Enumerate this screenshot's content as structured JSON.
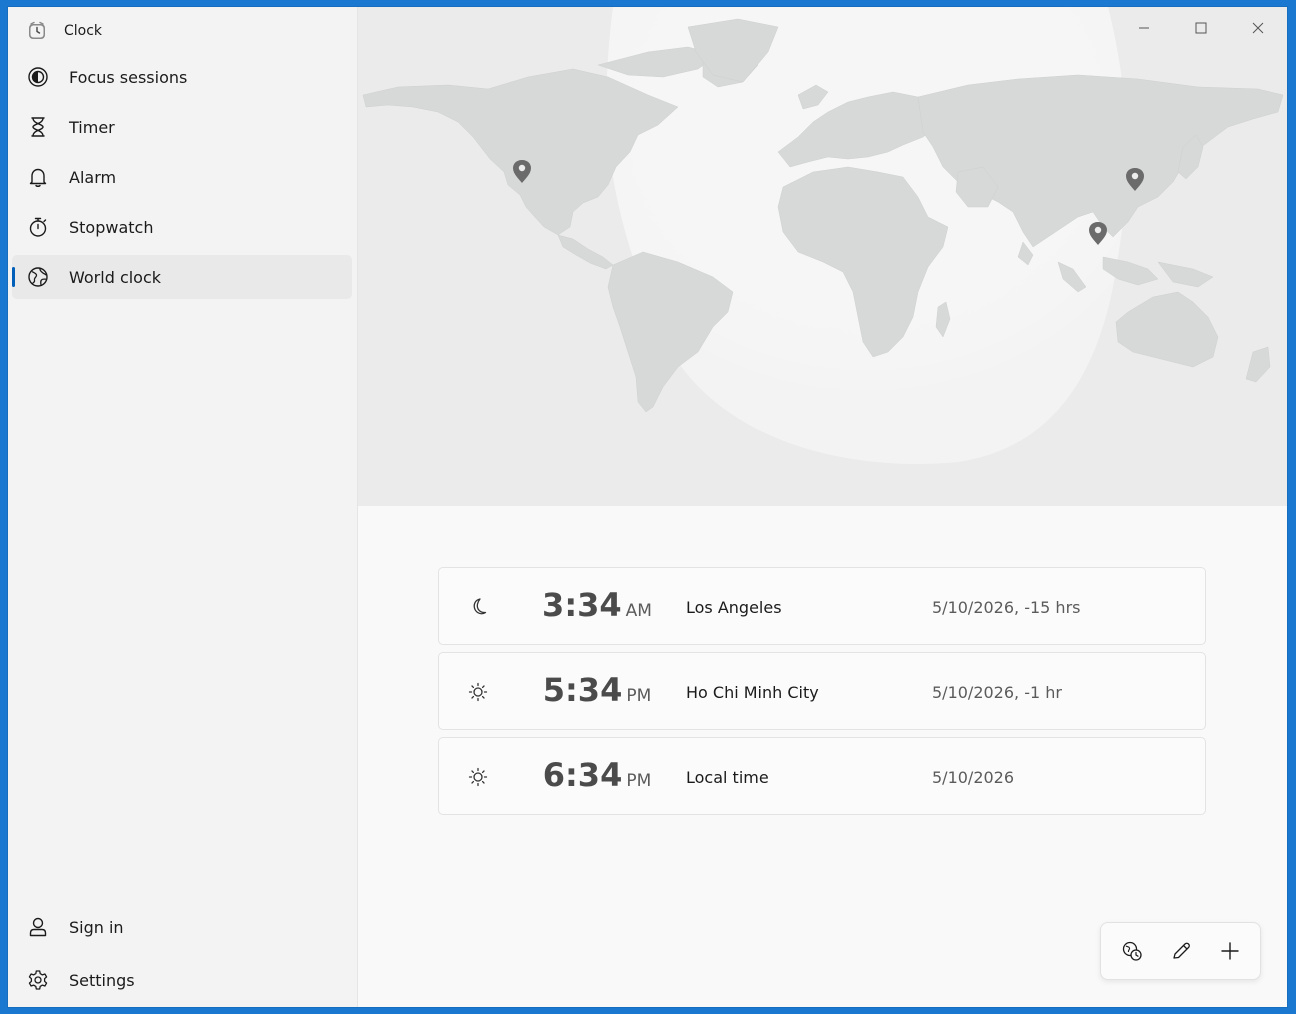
{
  "app": {
    "title": "Clock"
  },
  "sidebar": {
    "items": [
      {
        "label": "Focus sessions",
        "icon": "focus-icon"
      },
      {
        "label": "Timer",
        "icon": "hourglass-icon"
      },
      {
        "label": "Alarm",
        "icon": "bell-icon"
      },
      {
        "label": "Stopwatch",
        "icon": "stopwatch-icon"
      },
      {
        "label": "World clock",
        "icon": "globe-icon",
        "selected": true
      }
    ],
    "bottom": [
      {
        "label": "Sign in",
        "icon": "person-icon"
      },
      {
        "label": "Settings",
        "icon": "gear-icon"
      }
    ]
  },
  "world_clocks": [
    {
      "time": "3:34",
      "period": "AM",
      "city": "Los Angeles",
      "date": "5/10/2026, -15 hrs",
      "weather": "moon-icon"
    },
    {
      "time": "5:34",
      "period": "PM",
      "city": "Ho Chi Minh City",
      "date": "5/10/2026, -1 hr",
      "weather": "sun-icon"
    },
    {
      "time": "6:34",
      "period": "PM",
      "city": "Local time",
      "date": "5/10/2026",
      "weather": "sun-icon"
    }
  ],
  "map": {
    "pins": [
      "Los Angeles",
      "Seoul",
      "Ho Chi Minh City"
    ]
  },
  "colors": {
    "accent": "#005fb8",
    "window": "#f9f9f9",
    "sidebar": "#f3f3f3",
    "desktop": "#1a78d0"
  }
}
